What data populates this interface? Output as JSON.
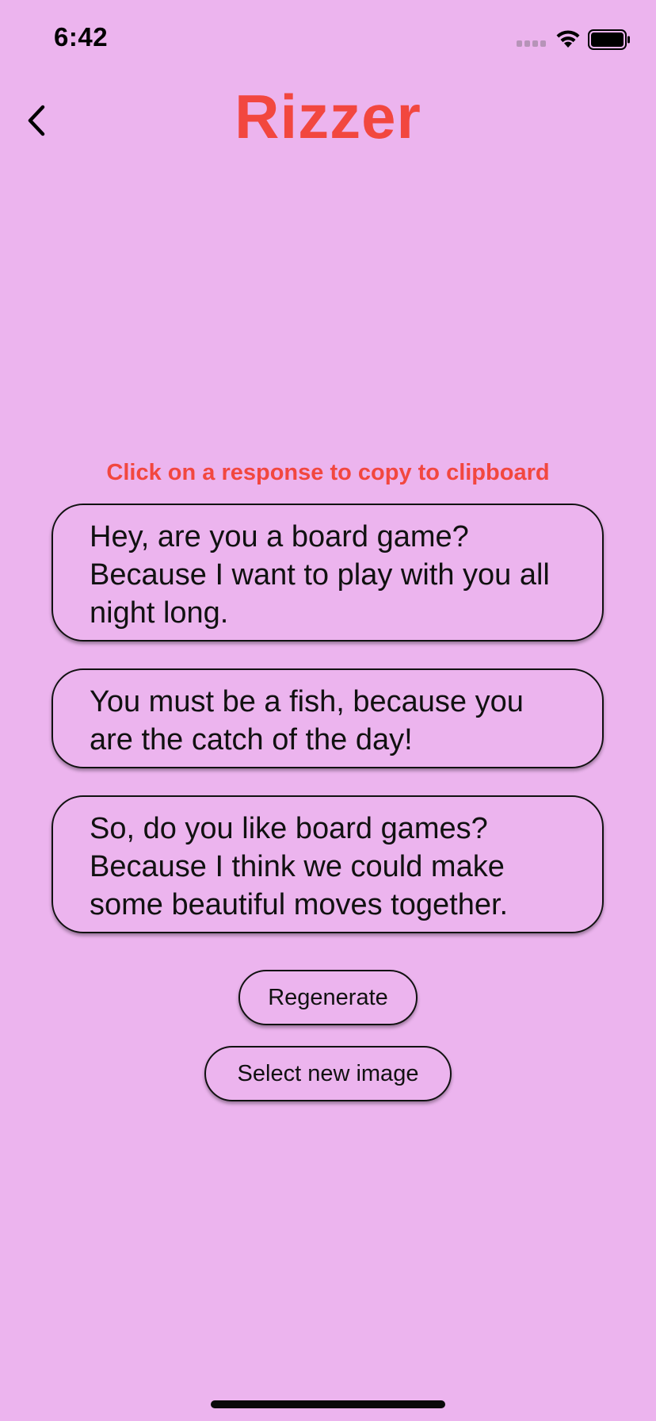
{
  "status_bar": {
    "time": "6:42",
    "icons": [
      "cellular-signal-icon",
      "wifi-icon",
      "battery-icon"
    ]
  },
  "header": {
    "back_icon": "chevron-left-icon",
    "title": "Rizzer"
  },
  "main": {
    "instruction": "Click on a response to copy to clipboard",
    "responses": [
      {
        "text": "Hey, are you a board game? Because I want to play with you all night long."
      },
      {
        "text": "You must be a fish, because you are the catch of the day!"
      },
      {
        "text": "So, do you like board games? Because I think we could make some beautiful moves together."
      }
    ],
    "regenerate_label": "Regenerate",
    "select_image_label": "Select new image"
  },
  "colors": {
    "background": "#ecb4ee",
    "accent": "#f2473f",
    "text": "#111111"
  }
}
